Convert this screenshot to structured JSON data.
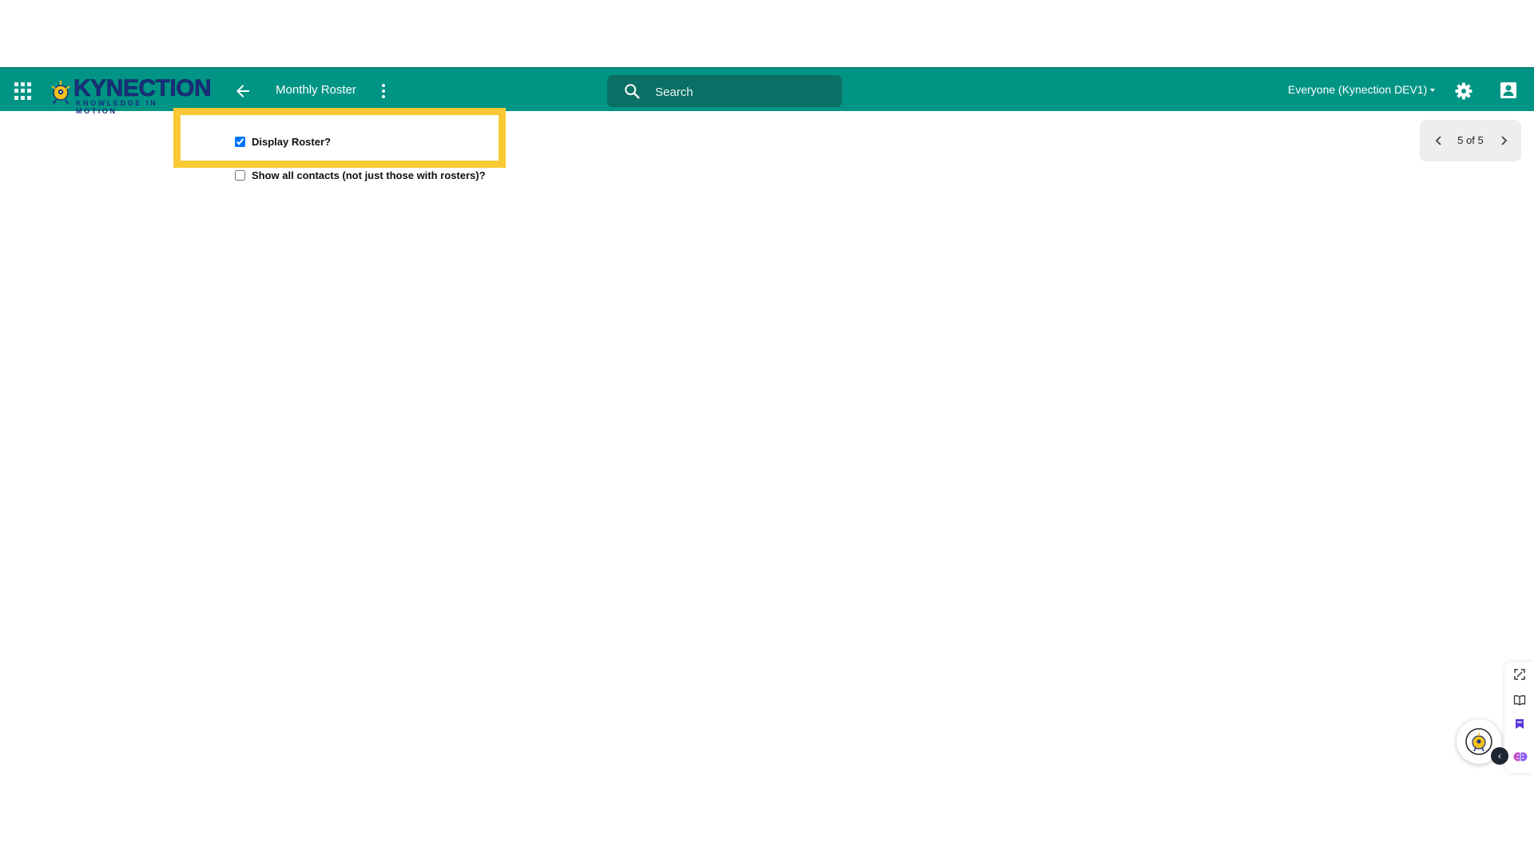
{
  "header": {
    "logo": {
      "word": "KYNECTION",
      "tagline": "KNOWLEDGE IN MOTION"
    },
    "page_title": "Monthly Roster",
    "search": {
      "placeholder": "Search"
    },
    "group_selector": {
      "value": "Everyone (Kynection DEV1)"
    },
    "icons": {
      "apps": "apps-grid-icon",
      "back": "arrow-left-icon",
      "menu": "more-vertical-icon",
      "search": "search-icon",
      "settings": "gear-icon",
      "account": "account-box-icon"
    },
    "colors": {
      "bar": "#009485",
      "search_bg": "#0a6f64"
    }
  },
  "form": {
    "display_roster": {
      "label": "Display Roster?",
      "checked": true
    },
    "show_all_contacts": {
      "label": "Show all contacts (not just those with rosters)?",
      "checked": false
    },
    "highlight_color": "#f8c934"
  },
  "pager": {
    "text": "5 of 5"
  },
  "side_tools": {
    "icons": [
      "screenshot-icon",
      "book-icon",
      "bookmark-icon",
      "brain-icon"
    ]
  },
  "assistant": {
    "icon": "assistant-avatar-icon"
  }
}
